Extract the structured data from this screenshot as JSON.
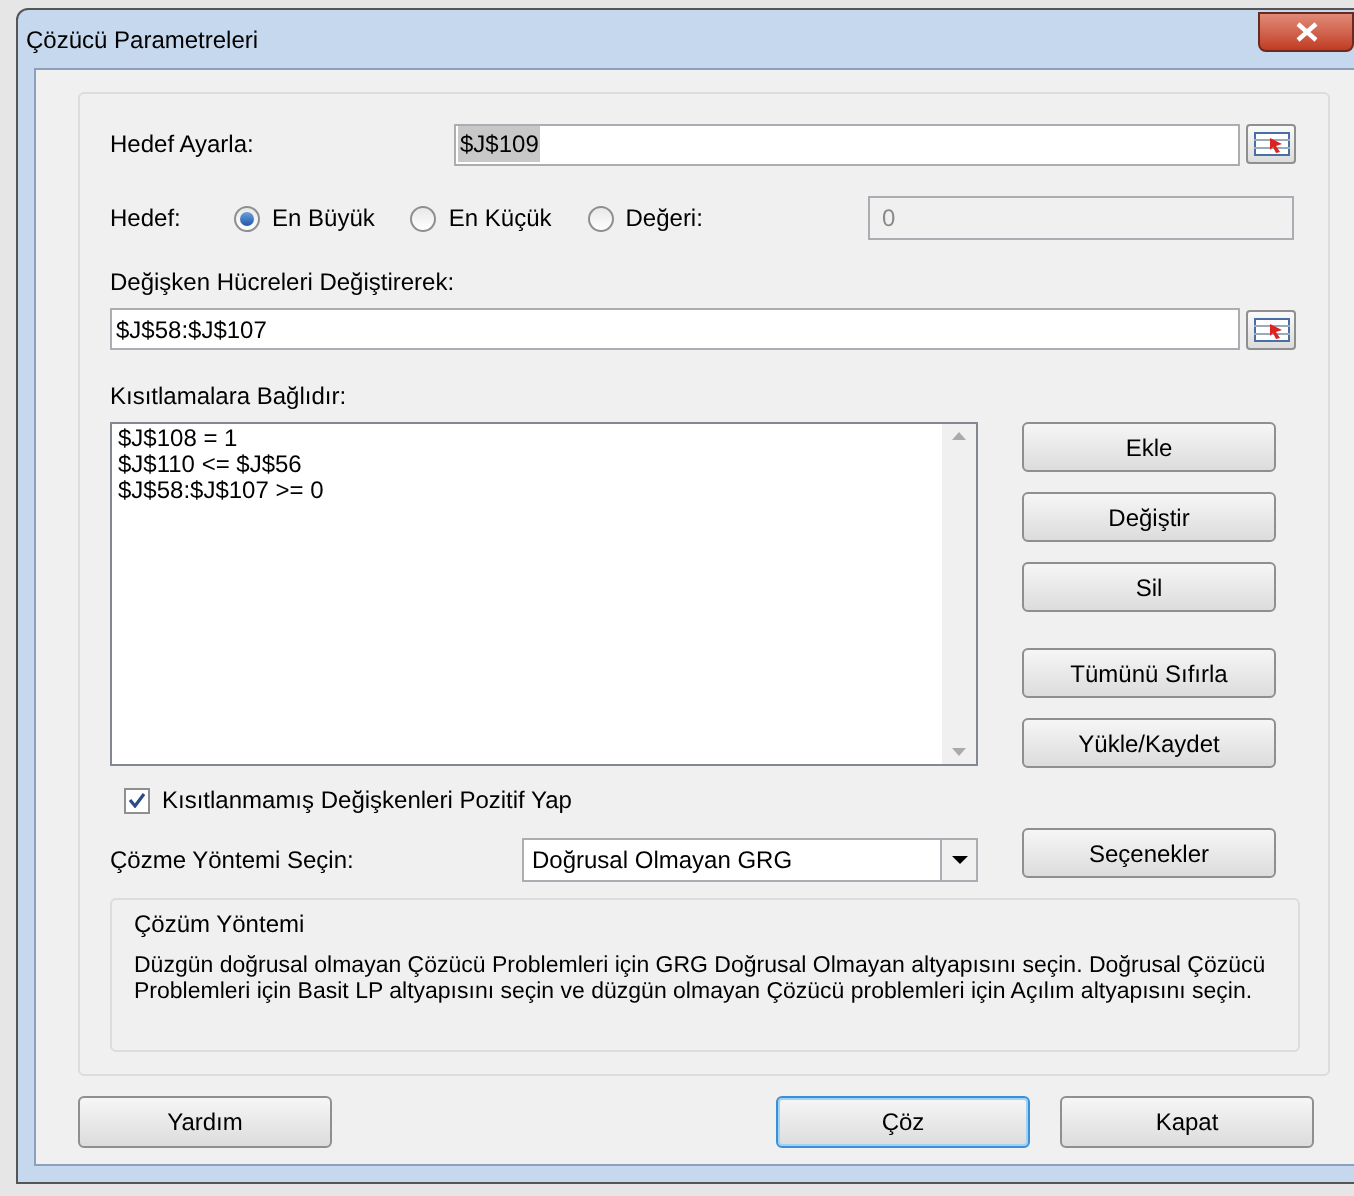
{
  "window": {
    "title": "Çözücü Parametreleri"
  },
  "target": {
    "label": "Hedef Ayarla:",
    "value": "$J$109"
  },
  "objective": {
    "label": "Hedef:",
    "options": [
      {
        "label": "En Büyük",
        "selected": true
      },
      {
        "label": "En Küçük",
        "selected": false
      },
      {
        "label": "Değeri:",
        "selected": false
      }
    ],
    "value": "0",
    "disabled": true
  },
  "variable_cells": {
    "label": "Değişken Hücreleri Değiştirerek:",
    "value": "$J$58:$J$107"
  },
  "constraints": {
    "label": "Kısıtlamalara Bağlıdır:",
    "items": [
      "$J$108 = 1",
      "$J$110 <= $J$56",
      "$J$58:$J$107 >= 0"
    ]
  },
  "side_buttons": [
    "Ekle",
    "Değiştir",
    "Sil",
    "Tümünü Sıfırla",
    "Yükle/Kaydet"
  ],
  "checkbox": {
    "label": "Kısıtlanmamış Değişkenleri Pozitif Yap",
    "checked": true
  },
  "method": {
    "label": "Çözme Yöntemi Seçin:",
    "value": "Doğrusal Olmayan GRG",
    "options_button": "Seçenekler"
  },
  "info": {
    "title": "Çözüm Yöntemi",
    "text": "Düzgün doğrusal olmayan Çözücü Problemleri için GRG Doğrusal Olmayan altyapısını seçin. Doğrusal Çözücü Problemleri için Basit LP altyapısını seçin ve düzgün olmayan Çözücü problemleri için Açılım altyapısını seçin."
  },
  "footer_buttons": [
    {
      "label": "Yardım",
      "default": false
    },
    {
      "label": "Çöz",
      "default": true
    },
    {
      "label": "Kapat",
      "default": false
    }
  ]
}
